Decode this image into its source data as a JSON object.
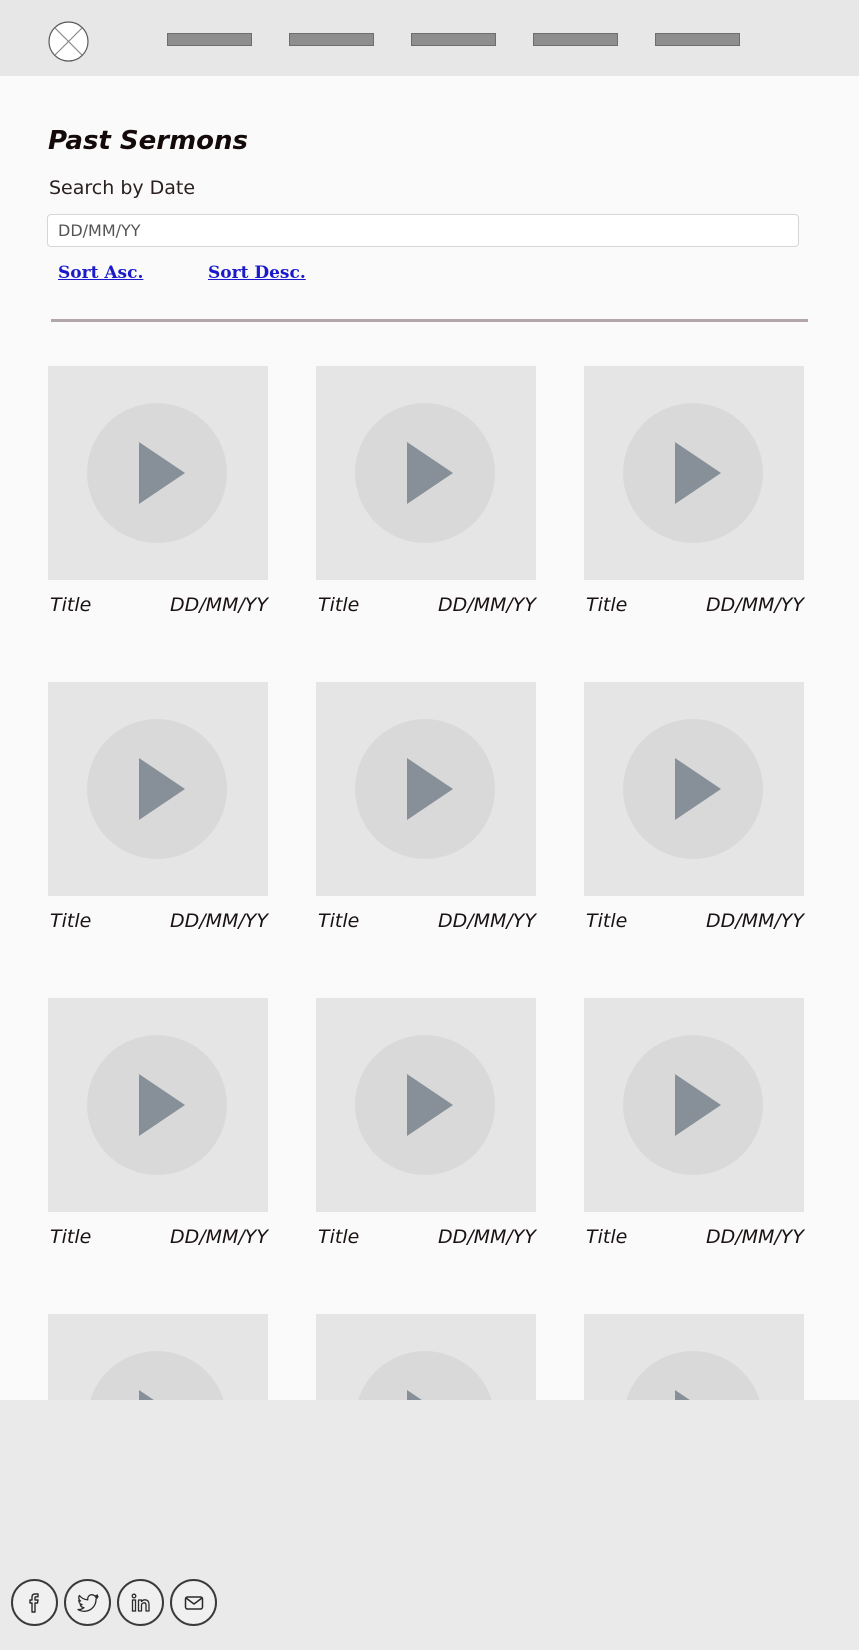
{
  "header": {
    "logo_icon": "close-circle-icon",
    "nav_items": [
      "nav-item-1",
      "nav-item-2",
      "nav-item-3",
      "nav-item-4",
      "nav-item-5"
    ]
  },
  "main": {
    "title": "Past Sermons",
    "search_label": "Search by Date",
    "search_placeholder": "DD/MM/YY",
    "sort_asc": "Sort Asc.",
    "sort_desc": "Sort Desc."
  },
  "sermons": [
    {
      "title": "Title",
      "date": "DD/MM/YY"
    },
    {
      "title": "Title",
      "date": "DD/MM/YY"
    },
    {
      "title": "Title",
      "date": "DD/MM/YY"
    },
    {
      "title": "Title",
      "date": "DD/MM/YY"
    },
    {
      "title": "Title",
      "date": "DD/MM/YY"
    },
    {
      "title": "Title",
      "date": "DD/MM/YY"
    },
    {
      "title": "Title",
      "date": "DD/MM/YY"
    },
    {
      "title": "Title",
      "date": "DD/MM/YY"
    },
    {
      "title": "Title",
      "date": "DD/MM/YY"
    }
  ],
  "footer": {
    "social_icons": [
      "facebook-icon",
      "twitter-icon",
      "linkedin-icon",
      "email-icon"
    ]
  },
  "colors": {
    "link": "#1a1acc",
    "play_icon": "#879098",
    "thumbnail_bg": "#e5e5e5",
    "divider": "#b3a6a9"
  }
}
